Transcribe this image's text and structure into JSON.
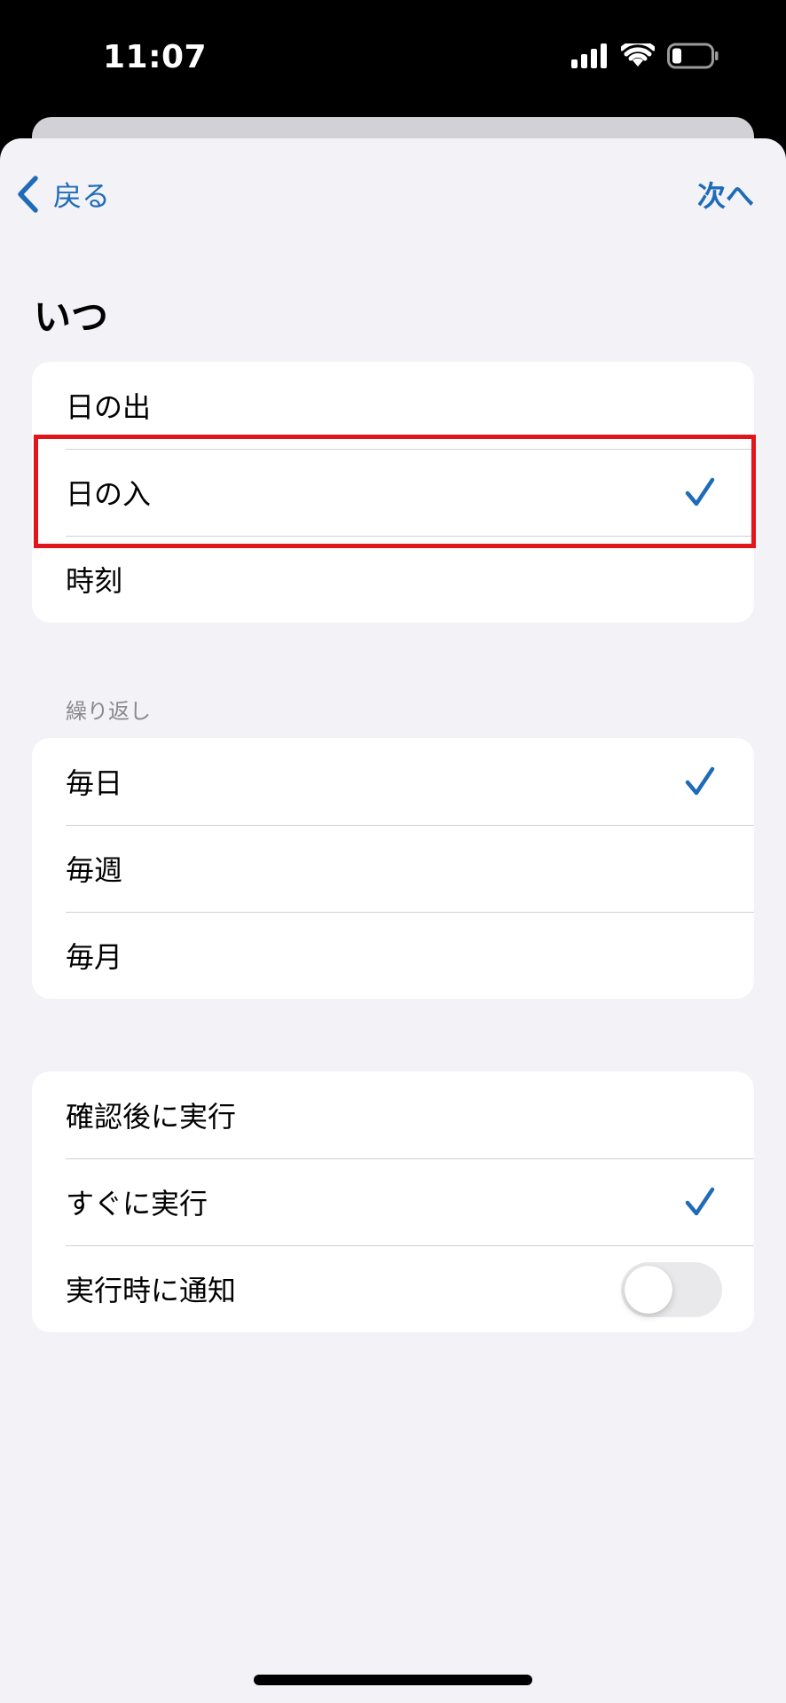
{
  "status": {
    "time": "11:07",
    "icons": [
      "cellular-signal-icon",
      "wifi-icon",
      "battery-low-icon"
    ]
  },
  "nav": {
    "back_label": "戻る",
    "next_label": "次へ"
  },
  "when": {
    "title": "いつ",
    "options": [
      {
        "label": "日の出",
        "selected": false
      },
      {
        "label": "日の入",
        "selected": true
      },
      {
        "label": "時刻",
        "selected": false
      }
    ]
  },
  "repeat": {
    "header": "繰り返し",
    "options": [
      {
        "label": "毎日",
        "selected": true
      },
      {
        "label": "毎週",
        "selected": false
      },
      {
        "label": "毎月",
        "selected": false
      }
    ]
  },
  "run": {
    "options": [
      {
        "label": "確認後に実行",
        "selected": false
      },
      {
        "label": "すぐに実行",
        "selected": true
      }
    ],
    "notify_label": "実行時に通知",
    "notify_on": false
  },
  "colors": {
    "accent": "#1f6bb8",
    "highlight": "#e0161b",
    "background": "#f2f2f7"
  }
}
